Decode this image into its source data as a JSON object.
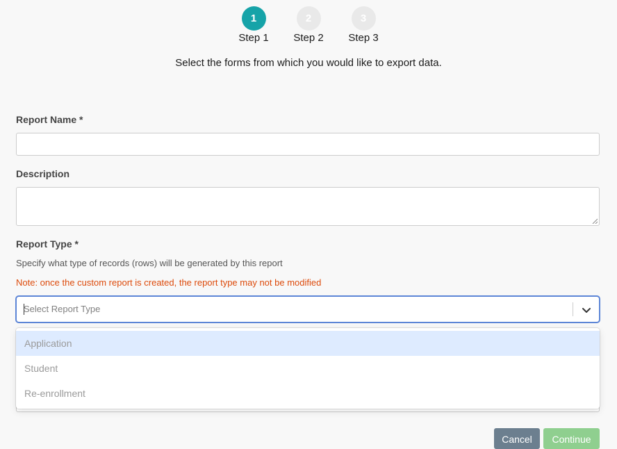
{
  "stepper": {
    "steps": [
      {
        "number": "1",
        "label": "Step 1",
        "state": "active"
      },
      {
        "number": "2",
        "label": "Step 2",
        "state": "inactive"
      },
      {
        "number": "3",
        "label": "Step 3",
        "state": "inactive"
      }
    ]
  },
  "intro_text": "Select the forms from which you would like to export data.",
  "form": {
    "report_name": {
      "label": "Report Name *",
      "value": ""
    },
    "description": {
      "label": "Description",
      "value": ""
    },
    "report_type": {
      "label": "Report Type *",
      "helper": "Specify what type of records (rows) will be generated by this report",
      "note": "Note: once the custom report is created, the report type may not be modified",
      "placeholder": "Select Report Type",
      "options": [
        "Application",
        "Student",
        "Re-enrollment"
      ],
      "highlighted_option": "Application"
    }
  },
  "buttons": {
    "cancel": "Cancel",
    "continue": "Continue"
  },
  "colors": {
    "active_step": "#16a3a8",
    "inactive_step": "#e9e9e9",
    "note_text": "#dd4b0c",
    "select_focus_border": "#5c85d6",
    "highlighted_option_bg": "#deebff",
    "cancel_button": "#6c7f8f",
    "continue_button": "#8fcf8f"
  },
  "icons": {
    "select_indicator": "chevron-down-icon",
    "textarea_grip": "resize-grip-icon"
  }
}
